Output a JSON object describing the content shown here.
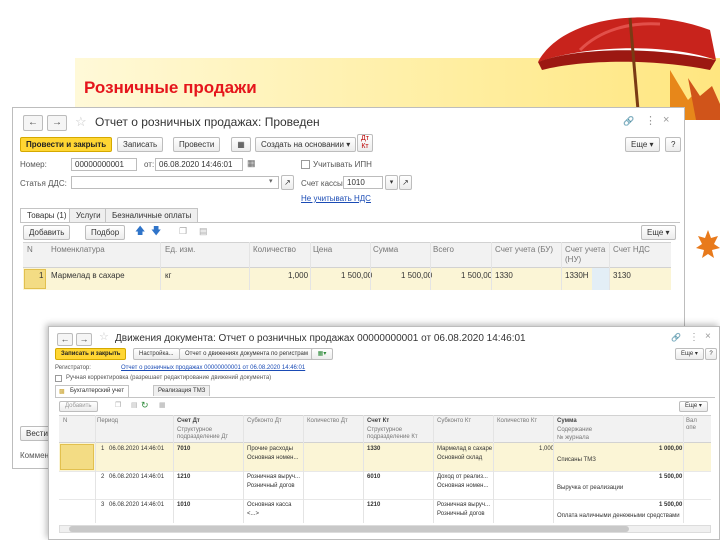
{
  "slide": {
    "title": "Розничные продажи",
    "title_color": "#e5151c"
  },
  "doc_window": {
    "title": "Отчет о розничных продажах: Проведен",
    "toolbar": {
      "post_close": "Провести и закрыть",
      "save": "Записать",
      "post": "Провести",
      "create_based_on": "Создать на основании",
      "more": "Еще",
      "help": "?"
    },
    "fields": {
      "number_label": "Номер:",
      "number_value": "00000000001",
      "date_label": "от:",
      "date_value": "06.08.2020 14:46:01",
      "vat_checkbox_label": "Учитывать ИПН",
      "dds_label": "Статья ДДС:",
      "dds_value": "",
      "cash_account_label": "Счет кассы:",
      "cash_account_value": "1010",
      "vat_link": "Не учитывать НДС"
    },
    "tabs": [
      {
        "label": "Товары (1)"
      },
      {
        "label": "Услуги"
      },
      {
        "label": "Безналичные оплаты"
      }
    ],
    "table_toolbar": {
      "add": "Добавить",
      "pick": "Подбор",
      "more": "Еще"
    },
    "columns": [
      "N",
      "Номенклатура",
      "Ед. изм.",
      "Количество",
      "Цена",
      "Сумма",
      "Всего",
      "Счет учета (БУ)",
      "Счет учета (НУ)",
      "Счет НДС"
    ],
    "rows": [
      {
        "n": "1",
        "item": "Мармелад в сахаре",
        "unit": "кг",
        "qty": "1,000",
        "price": "1 500,00",
        "sum": "1 500,00",
        "total": "1 500,00",
        "acc_bu": "1330",
        "acc_nu": "1330Н",
        "acc_vat": "3130"
      }
    ],
    "bottom": {
      "post_cut": "Вести",
      "comment_cut": "Коммент"
    }
  },
  "moves_window": {
    "title": "Движения документа: Отчет о розничных продажах 00000000001 от 06.08.2020 14:46:01",
    "toolbar": {
      "save_close": "Записать и закрыть",
      "settings": "Настройка...",
      "report": "Отчет о движениях документа по регистрам",
      "more": "Еще"
    },
    "registrar_label": "Регистратор:",
    "registrar_link": "Отчет о розничных продажах 00000000001 от 06.08.2020 14:46:01",
    "manual_label": "Ручная корректировка (разрешает редактирование движений документа)",
    "tabs": [
      {
        "label": "Бухгалтерский учет"
      },
      {
        "label": "Реализация ТМЗ"
      }
    ],
    "table_toolbar": {
      "add": "Добавить",
      "more": "Еще"
    },
    "columns": {
      "n": "N",
      "period": "Период",
      "acc_dt": "Счет Дт",
      "acc_dt_sub": "Структурное подразделение Дт",
      "subconto_dt": "Субконто Дт",
      "qty_dt": "Количество Дт",
      "acc_kt": "Счет Кт",
      "acc_kt_sub": "Структурное подразделение Кт",
      "subconto_kt": "Субконто Кт",
      "qty_kt": "Количество Кт",
      "sum": "Сумма",
      "content": "Содержание",
      "journal": "№ журнала",
      "cut": "Вал опе"
    },
    "rows": [
      {
        "n": "1",
        "period": "06.08.2020 14:46:01",
        "acc_dt": "7010",
        "sub_dt_1": "Прочие расходы",
        "sub_dt_2": "Основная номен...",
        "acc_kt": "1330",
        "sub_kt_1": "Мармелад в сахаре",
        "sub_kt_2": "Основной склад",
        "qty_kt": "1,000",
        "sum": "1 000,00",
        "content": "Списаны ТМЗ"
      },
      {
        "n": "2",
        "period": "06.08.2020 14:46:01",
        "acc_dt": "1210",
        "sub_dt_1": "Розничная выруч...",
        "sub_dt_2": "Розничный догов",
        "acc_kt": "6010",
        "sub_kt_1": "Доход от реализ...",
        "sub_kt_2": "Основная номен...",
        "qty_kt": "",
        "sum": "1 500,00",
        "content": "Выручка от реализации"
      },
      {
        "n": "3",
        "period": "06.08.2020 14:46:01",
        "acc_dt": "1010",
        "sub_dt_1": "Основная касса",
        "sub_dt_2": "<...>",
        "acc_kt": "1210",
        "sub_kt_1": "Розничная выруч...",
        "sub_kt_2": "Розничный догов",
        "qty_kt": "",
        "sum": "1 500,00",
        "content": "Оплата наличными денежными средствами"
      }
    ]
  },
  "icons": [
    "umbrella-icon",
    "maple-leaf-icon",
    "back-arrow-icon",
    "forward-arrow-icon",
    "star-icon",
    "link-icon",
    "menu-dots-icon",
    "close-icon",
    "calendar-icon",
    "dropdown-icon",
    "up-arrow-icon",
    "down-arrow-icon",
    "copy-icon",
    "refresh-icon"
  ]
}
